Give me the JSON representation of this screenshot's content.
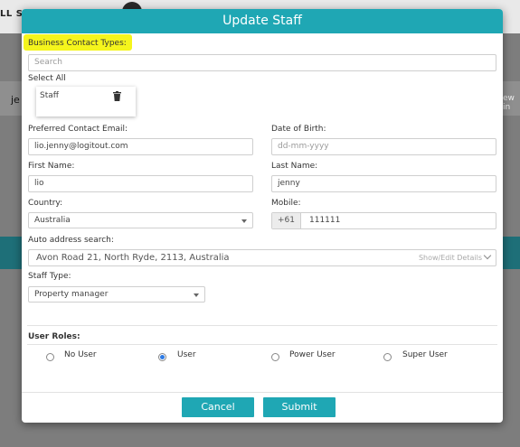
{
  "background": {
    "top_text": "LL SE",
    "band_text": "je",
    "band_right_text": "ew in"
  },
  "modal": {
    "title": "Update Staff",
    "business_contact_types_label": "Business Contact Types:",
    "search_placeholder": "Search",
    "select_all_label": "Select All",
    "selected_types": [
      "Staff"
    ],
    "preferred_email_label": "Preferred Contact Email:",
    "preferred_email_value": "lio.jenny@logitout.com",
    "dob_label": "Date of Birth:",
    "dob_placeholder": "dd-mm-yyyy",
    "first_name_label": "First Name:",
    "first_name_value": "lio",
    "last_name_label": "Last Name:",
    "last_name_value": "jenny",
    "country_label": "Country:",
    "country_value": "Australia",
    "mobile_label": "Mobile:",
    "mobile_prefix": "+61",
    "mobile_value": "111111",
    "address_label": "Auto address search:",
    "address_value": "Avon Road 21, North Ryde, 2113, Australia",
    "address_toggle": "Show/Edit Details",
    "staff_type_label": "Staff Type:",
    "staff_type_value": "Property manager",
    "user_roles_label": "User Roles:",
    "roles": [
      "No User",
      "User",
      "Power User",
      "Super User"
    ],
    "selected_role": "User",
    "cancel_label": "Cancel",
    "submit_label": "Submit"
  },
  "colors": {
    "header": "#1fa7b4",
    "button": "#1fa7b4",
    "highlight": "#f5f51c"
  }
}
